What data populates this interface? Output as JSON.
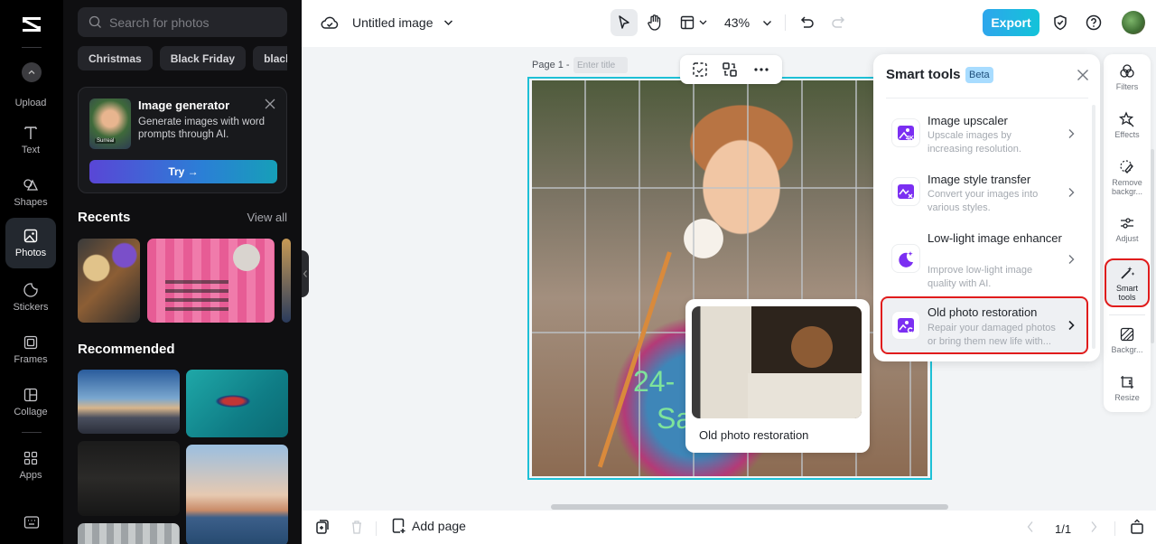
{
  "app": {
    "doc_title": "Untitled image",
    "zoom": "43%"
  },
  "rail": {
    "items": [
      {
        "label": "Upload",
        "icon": "upload-icon"
      },
      {
        "label": "Text",
        "icon": "text-icon"
      },
      {
        "label": "Shapes",
        "icon": "shapes-icon"
      },
      {
        "label": "Photos",
        "icon": "photo-icon",
        "active": true
      },
      {
        "label": "Stickers",
        "icon": "sticker-icon"
      },
      {
        "label": "Frames",
        "icon": "frame-icon"
      },
      {
        "label": "Collage",
        "icon": "collage-icon"
      },
      {
        "label": "Apps",
        "icon": "apps-icon"
      }
    ]
  },
  "panel": {
    "search_placeholder": "Search for photos",
    "chips": [
      "Christmas",
      "Black Friday",
      "black"
    ],
    "generator": {
      "title": "Image generator",
      "description": "Generate images with word prompts through AI.",
      "thumb_badge": "Surreal",
      "try_label": "Try →"
    },
    "recents_title": "Recents",
    "view_all": "View all",
    "recommended_title": "Recommended"
  },
  "canvas": {
    "page_label": "Page 1 -",
    "title_placeholder": "Enter title",
    "overlay_text_1": "24-",
    "overlay_text_2": "Sa",
    "tooltip_caption": "Old photo restoration"
  },
  "bottom": {
    "add_page": "Add page",
    "pager": "1/1"
  },
  "topbar": {
    "export_label": "Export"
  },
  "smart_tools": {
    "title": "Smart tools",
    "badge": "Beta",
    "items": [
      {
        "name": "Image upscaler",
        "description_1": "Upscale images by",
        "description_2": "increasing resolution."
      },
      {
        "name": "Image style transfer",
        "description_1": "Convert your images into",
        "description_2": "various styles."
      },
      {
        "name": "Low-light image enhancer",
        "description_1": "Improve low-light image",
        "description_2": "quality with AI."
      },
      {
        "name": "Old photo restoration",
        "description_1": "Repair your damaged photos",
        "description_2": "or bring them new life with...",
        "highlighted": true
      }
    ]
  },
  "right_tools": {
    "items": [
      {
        "label": "Filters"
      },
      {
        "label": "Effects"
      },
      {
        "label": "Remove backgr..."
      },
      {
        "label": "Adjust"
      },
      {
        "label": "Smart tools",
        "active": true
      },
      {
        "label": "Backgr..."
      },
      {
        "label": "Resize"
      }
    ]
  },
  "colors": {
    "accent": "#1ec0d6",
    "export_gradient_start": "#2ea6ec",
    "export_gradient_end": "#13c3d9",
    "smart_icon_purple": "#7b2ff2",
    "highlight_red": "#e01c1c"
  }
}
